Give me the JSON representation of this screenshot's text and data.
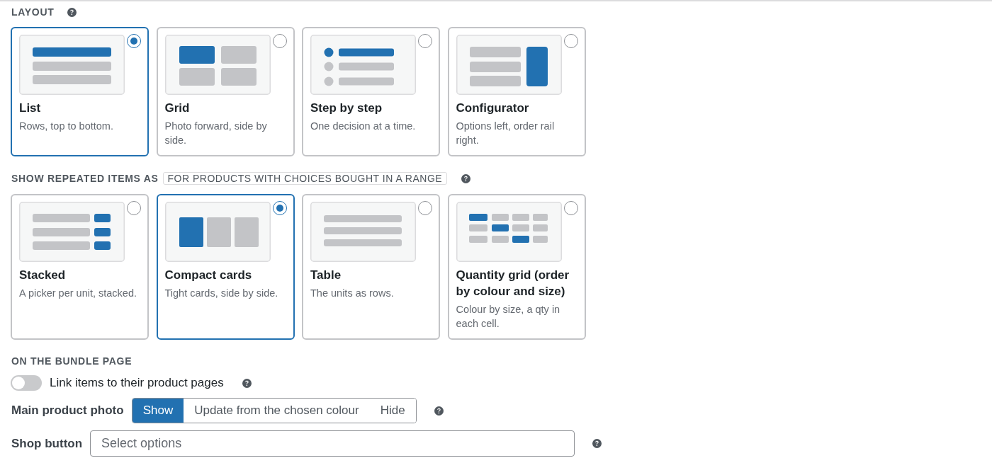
{
  "layout": {
    "heading": "LAYOUT",
    "options": [
      {
        "kind": "list",
        "title": "List",
        "description": "Rows, top to bottom.",
        "selected": true
      },
      {
        "kind": "grid",
        "title": "Grid",
        "description": "Photo forward, side by side.",
        "selected": false
      },
      {
        "kind": "steps",
        "title": "Step by step",
        "description": "One decision at a time.",
        "selected": false
      },
      {
        "kind": "configurator",
        "title": "Configurator",
        "description": "Options left, order rail right.",
        "selected": false
      }
    ]
  },
  "repeated_items": {
    "heading": "SHOW REPEATED ITEMS AS",
    "tag": "FOR PRODUCTS WITH CHOICES BOUGHT IN A RANGE",
    "options": [
      {
        "kind": "stacked",
        "title": "Stacked",
        "description": "A picker per unit, stacked.",
        "selected": false
      },
      {
        "kind": "compact_cards",
        "title": "Compact cards",
        "description": "Tight cards, side by side.",
        "selected": true
      },
      {
        "kind": "table",
        "title": "Table",
        "description": "The units as rows.",
        "selected": false
      },
      {
        "kind": "quantity_grid",
        "title": "Quantity grid (order by colour and size)",
        "description": "Colour by size, a qty in each cell.",
        "selected": false
      }
    ]
  },
  "bundle_page": {
    "heading": "ON THE BUNDLE PAGE",
    "link_items": {
      "label": "Link items to their product pages",
      "on": false
    },
    "main_product_photo": {
      "label": "Main product photo",
      "options": [
        {
          "label": "Show",
          "selected": true
        },
        {
          "label": "Update from the chosen colour",
          "selected": false
        },
        {
          "label": "Hide",
          "selected": false
        }
      ]
    },
    "shop_button": {
      "label": "Shop button",
      "placeholder": "Select options"
    }
  }
}
